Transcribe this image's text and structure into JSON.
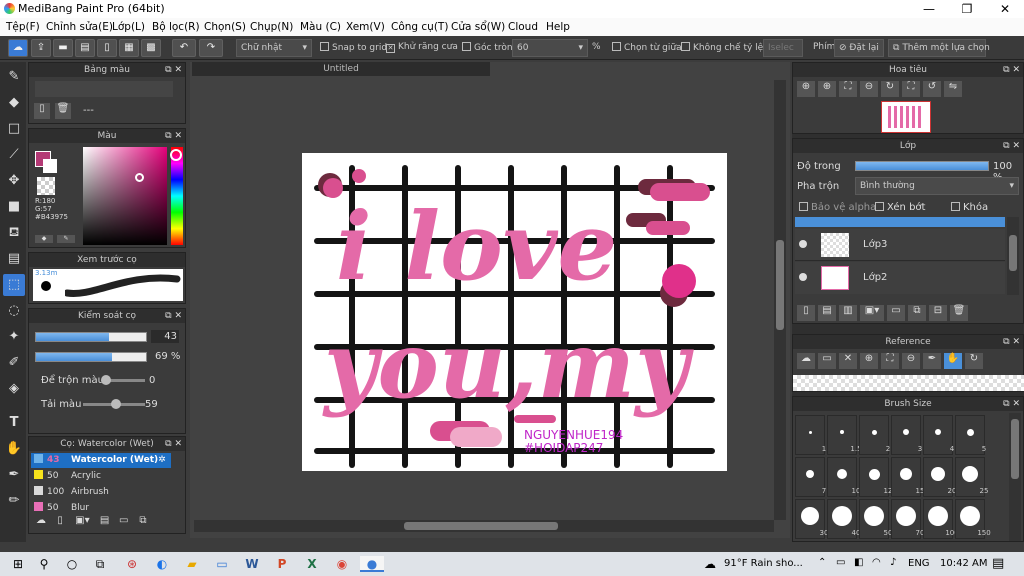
{
  "app": {
    "title": "MediBang Paint Pro (64bit)",
    "min": "—",
    "max": "❐",
    "close": "✕"
  },
  "menu": [
    "Tệp(F)",
    "Chỉnh sửa(E)",
    "Lớp(L)",
    "Bộ lọc(R)",
    "Chọn(S)",
    "Chụp(N)",
    "Màu (C)",
    "Xem(V)",
    "Công cụ(T)",
    "Cửa sổ(W)",
    "Cloud",
    "Help"
  ],
  "toolbar": {
    "selection_mode": "Chữ nhật",
    "snap": "Snap to grid",
    "antialias": "Khử răng cưa",
    "round_corner": "Góc tròn",
    "round_value": "60",
    "percent": "%",
    "select_center": "Chọn từ giữa",
    "no_ratio": "Không chế tỷ lệ",
    "placeholder": "Iselec",
    "hotkey": "Phím",
    "reset": "Đặt lại",
    "add_selection": "Thêm một lựa chọn"
  },
  "palette": {
    "title": "Bảng màu",
    "value": "---"
  },
  "color": {
    "title": "Màu",
    "r": "R:180",
    "g": "G:57",
    "b": "B:117",
    "hex": "#B43975",
    "main_color": "#B43975"
  },
  "preview": {
    "title": "Xem trước cọ",
    "size": "3.13m"
  },
  "brush_control": {
    "title": "Kiểm soát cọ",
    "size_value": "43",
    "opacity_value": "69 %",
    "blend_label": "Để trộn màu",
    "blend_value": "0",
    "reload_label": "Tải màu",
    "reload_value": "59",
    "size_fill": 0.66,
    "opacity_fill": 0.69
  },
  "brush_list": {
    "title": "Cọ: Watercolor (Wet)",
    "items": [
      {
        "size": "43",
        "name": "Watercolor (Wet)✲",
        "color": "#6fb4ea"
      },
      {
        "size": "50",
        "name": "Acrylic",
        "color": "#f7e31c"
      },
      {
        "size": "100",
        "name": "Airbrush",
        "color": "#d9d9d9"
      },
      {
        "size": "50",
        "name": "Blur",
        "color": "#e86fb7"
      }
    ]
  },
  "document": {
    "tab": "Untitled"
  },
  "artwork": {
    "line1": "i love",
    "line2": "you,my",
    "sign1": "NGUYENHUE194",
    "sign2": "#HOIDAP247"
  },
  "navigator": {
    "title": "Hoa tiêu"
  },
  "layers": {
    "title": "Lớp",
    "opacity_label": "Độ trong",
    "opacity_value": "100 %",
    "blend_label": "Pha trộn",
    "blend_value": "Bình thường",
    "protect_alpha": "Bảo vệ alpha",
    "clipping": "Xén bớt",
    "lock": "Khóa",
    "items": [
      "Lớp3",
      "Lớp2"
    ]
  },
  "reference": {
    "title": "Reference"
  },
  "brush_size": {
    "title": "Brush Size",
    "sizes": [
      "1",
      "1.5",
      "2",
      "3",
      "4",
      "5",
      "7",
      "10",
      "12",
      "15",
      "20",
      "25",
      "30",
      "40",
      "50",
      "70",
      "100",
      "150"
    ]
  },
  "taskbar": {
    "weather": "91°F  Rain sho...",
    "lang": "ENG",
    "time": "10:42 AM"
  }
}
